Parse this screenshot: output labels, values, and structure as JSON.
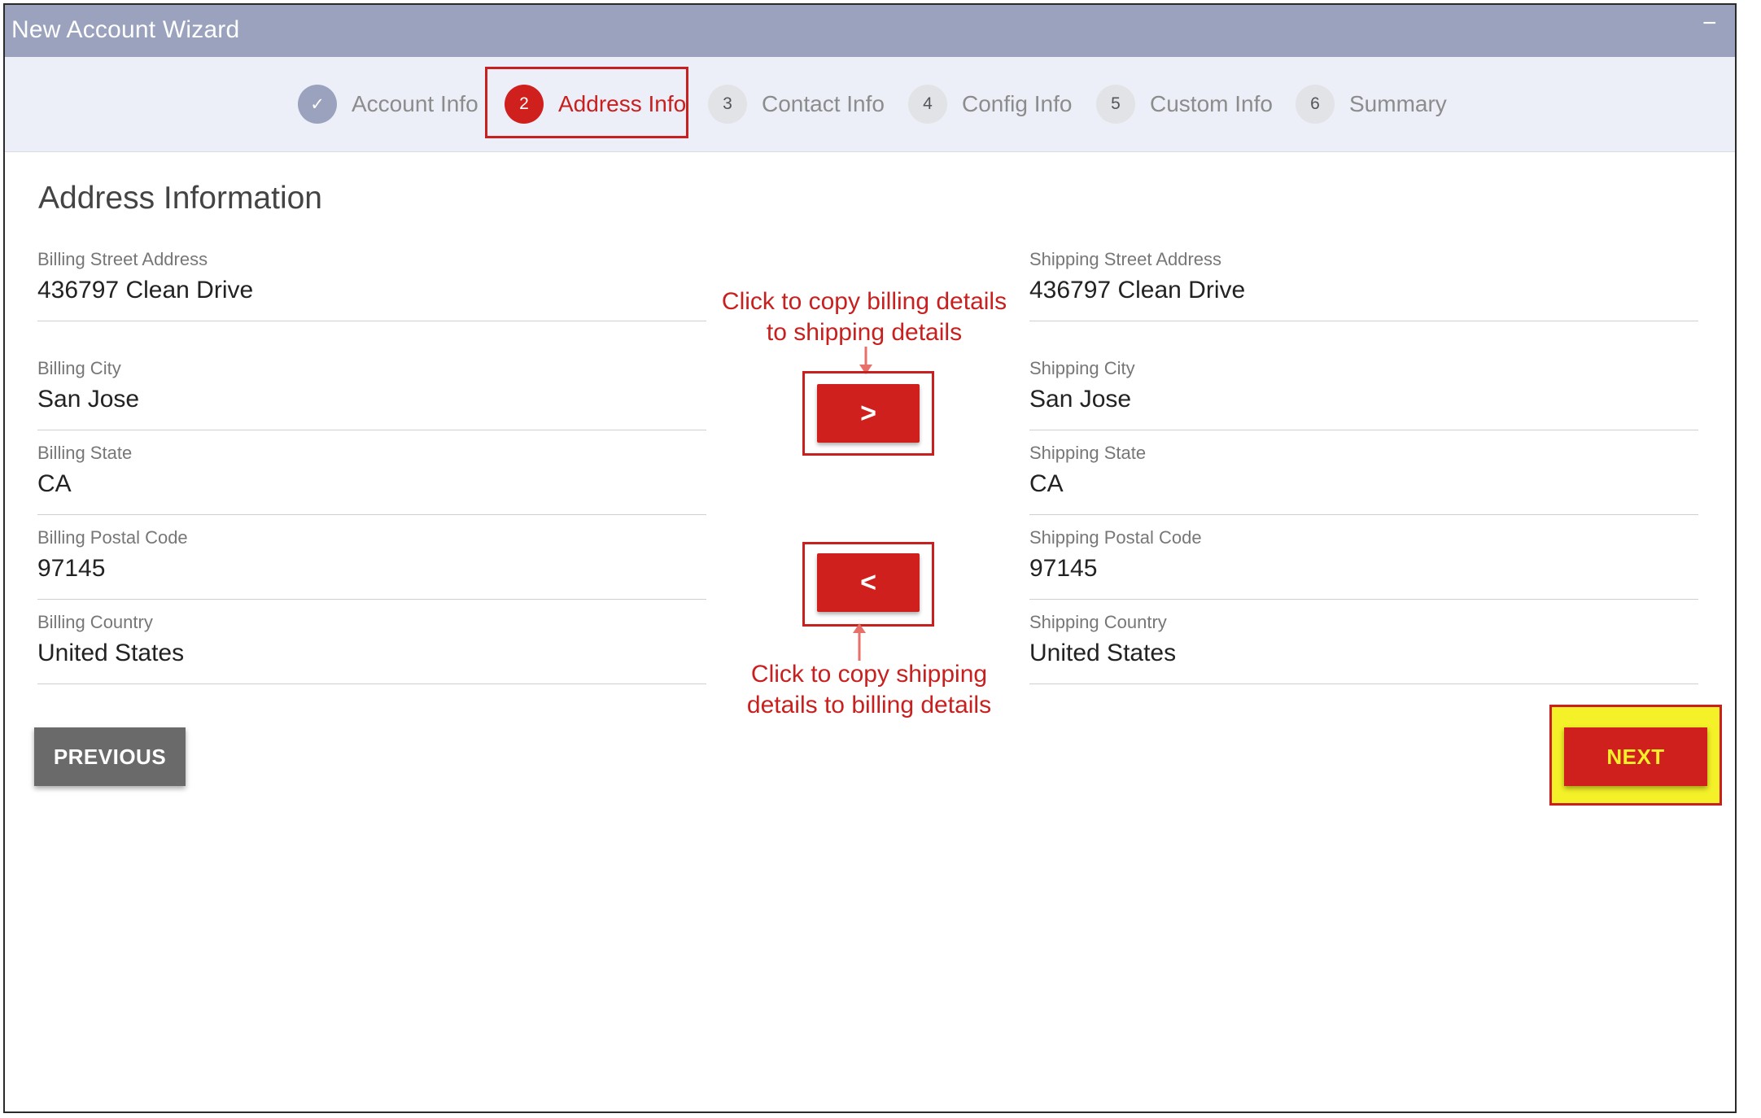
{
  "window": {
    "title": "New Account Wizard",
    "minimize_glyph": "−",
    "close_glyph": "✕"
  },
  "steps": [
    {
      "number": "✓",
      "label": "Account Info",
      "state": "done"
    },
    {
      "number": "2",
      "label": "Address Info",
      "state": "active"
    },
    {
      "number": "3",
      "label": "Contact Info",
      "state": "pending"
    },
    {
      "number": "4",
      "label": "Config Info",
      "state": "pending"
    },
    {
      "number": "5",
      "label": "Custom Info",
      "state": "pending"
    },
    {
      "number": "6",
      "label": "Summary",
      "state": "pending"
    }
  ],
  "section_title": "Address Information",
  "billing": {
    "street": {
      "label": "Billing Street Address",
      "value": "436797 Clean Drive"
    },
    "city": {
      "label": "Billing City",
      "value": "San Jose"
    },
    "state": {
      "label": "Billing State",
      "value": "CA"
    },
    "postal": {
      "label": "Billing Postal Code",
      "value": "97145"
    },
    "country": {
      "label": "Billing Country",
      "value": "United States"
    }
  },
  "shipping": {
    "street": {
      "label": "Shipping Street Address",
      "value": "436797 Clean Drive"
    },
    "city": {
      "label": "Shipping City",
      "value": "San Jose"
    },
    "state": {
      "label": "Shipping State",
      "value": "CA"
    },
    "postal": {
      "label": "Shipping Postal Code",
      "value": "97145"
    },
    "country": {
      "label": "Shipping Country",
      "value": "United States"
    }
  },
  "copy_buttons": {
    "to_shipping": ">",
    "to_billing": "<"
  },
  "annotations": {
    "to_shipping_line1": "Click to copy billing details",
    "to_shipping_line2": "to shipping details",
    "to_billing_line1": "Click to copy shipping",
    "to_billing_line2": "details to billing details"
  },
  "buttons": {
    "previous": "PREVIOUS",
    "next": "NEXT"
  },
  "colors": {
    "accent_red": "#d0201e",
    "titlebar": "#9aa2bd",
    "highlight_yellow": "#f4f128"
  }
}
